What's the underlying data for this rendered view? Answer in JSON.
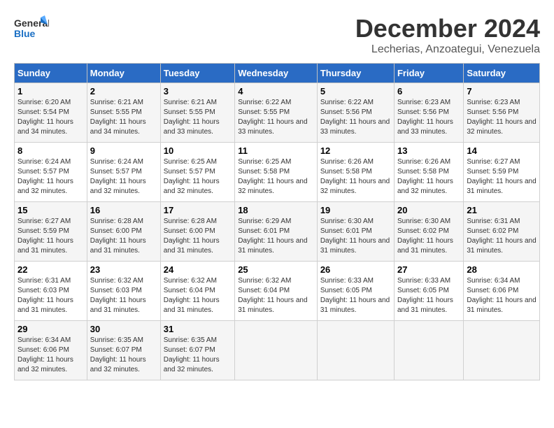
{
  "logo": {
    "general": "General",
    "blue": "Blue"
  },
  "title": "December 2024",
  "location": "Lecherias, Anzoategui, Venezuela",
  "days_of_week": [
    "Sunday",
    "Monday",
    "Tuesday",
    "Wednesday",
    "Thursday",
    "Friday",
    "Saturday"
  ],
  "weeks": [
    [
      {
        "day": "1",
        "sunrise": "6:20 AM",
        "sunset": "5:54 PM",
        "daylight": "11 hours and 34 minutes."
      },
      {
        "day": "2",
        "sunrise": "6:21 AM",
        "sunset": "5:55 PM",
        "daylight": "11 hours and 34 minutes."
      },
      {
        "day": "3",
        "sunrise": "6:21 AM",
        "sunset": "5:55 PM",
        "daylight": "11 hours and 33 minutes."
      },
      {
        "day": "4",
        "sunrise": "6:22 AM",
        "sunset": "5:55 PM",
        "daylight": "11 hours and 33 minutes."
      },
      {
        "day": "5",
        "sunrise": "6:22 AM",
        "sunset": "5:56 PM",
        "daylight": "11 hours and 33 minutes."
      },
      {
        "day": "6",
        "sunrise": "6:23 AM",
        "sunset": "5:56 PM",
        "daylight": "11 hours and 33 minutes."
      },
      {
        "day": "7",
        "sunrise": "6:23 AM",
        "sunset": "5:56 PM",
        "daylight": "11 hours and 32 minutes."
      }
    ],
    [
      {
        "day": "8",
        "sunrise": "6:24 AM",
        "sunset": "5:57 PM",
        "daylight": "11 hours and 32 minutes."
      },
      {
        "day": "9",
        "sunrise": "6:24 AM",
        "sunset": "5:57 PM",
        "daylight": "11 hours and 32 minutes."
      },
      {
        "day": "10",
        "sunrise": "6:25 AM",
        "sunset": "5:57 PM",
        "daylight": "11 hours and 32 minutes."
      },
      {
        "day": "11",
        "sunrise": "6:25 AM",
        "sunset": "5:58 PM",
        "daylight": "11 hours and 32 minutes."
      },
      {
        "day": "12",
        "sunrise": "6:26 AM",
        "sunset": "5:58 PM",
        "daylight": "11 hours and 32 minutes."
      },
      {
        "day": "13",
        "sunrise": "6:26 AM",
        "sunset": "5:58 PM",
        "daylight": "11 hours and 32 minutes."
      },
      {
        "day": "14",
        "sunrise": "6:27 AM",
        "sunset": "5:59 PM",
        "daylight": "11 hours and 31 minutes."
      }
    ],
    [
      {
        "day": "15",
        "sunrise": "6:27 AM",
        "sunset": "5:59 PM",
        "daylight": "11 hours and 31 minutes."
      },
      {
        "day": "16",
        "sunrise": "6:28 AM",
        "sunset": "6:00 PM",
        "daylight": "11 hours and 31 minutes."
      },
      {
        "day": "17",
        "sunrise": "6:28 AM",
        "sunset": "6:00 PM",
        "daylight": "11 hours and 31 minutes."
      },
      {
        "day": "18",
        "sunrise": "6:29 AM",
        "sunset": "6:01 PM",
        "daylight": "11 hours and 31 minutes."
      },
      {
        "day": "19",
        "sunrise": "6:30 AM",
        "sunset": "6:01 PM",
        "daylight": "11 hours and 31 minutes."
      },
      {
        "day": "20",
        "sunrise": "6:30 AM",
        "sunset": "6:02 PM",
        "daylight": "11 hours and 31 minutes."
      },
      {
        "day": "21",
        "sunrise": "6:31 AM",
        "sunset": "6:02 PM",
        "daylight": "11 hours and 31 minutes."
      }
    ],
    [
      {
        "day": "22",
        "sunrise": "6:31 AM",
        "sunset": "6:03 PM",
        "daylight": "11 hours and 31 minutes."
      },
      {
        "day": "23",
        "sunrise": "6:32 AM",
        "sunset": "6:03 PM",
        "daylight": "11 hours and 31 minutes."
      },
      {
        "day": "24",
        "sunrise": "6:32 AM",
        "sunset": "6:04 PM",
        "daylight": "11 hours and 31 minutes."
      },
      {
        "day": "25",
        "sunrise": "6:32 AM",
        "sunset": "6:04 PM",
        "daylight": "11 hours and 31 minutes."
      },
      {
        "day": "26",
        "sunrise": "6:33 AM",
        "sunset": "6:05 PM",
        "daylight": "11 hours and 31 minutes."
      },
      {
        "day": "27",
        "sunrise": "6:33 AM",
        "sunset": "6:05 PM",
        "daylight": "11 hours and 31 minutes."
      },
      {
        "day": "28",
        "sunrise": "6:34 AM",
        "sunset": "6:06 PM",
        "daylight": "11 hours and 31 minutes."
      }
    ],
    [
      {
        "day": "29",
        "sunrise": "6:34 AM",
        "sunset": "6:06 PM",
        "daylight": "11 hours and 32 minutes."
      },
      {
        "day": "30",
        "sunrise": "6:35 AM",
        "sunset": "6:07 PM",
        "daylight": "11 hours and 32 minutes."
      },
      {
        "day": "31",
        "sunrise": "6:35 AM",
        "sunset": "6:07 PM",
        "daylight": "11 hours and 32 minutes."
      },
      null,
      null,
      null,
      null
    ]
  ],
  "labels": {
    "sunrise": "Sunrise:",
    "sunset": "Sunset:",
    "daylight": "Daylight:"
  }
}
